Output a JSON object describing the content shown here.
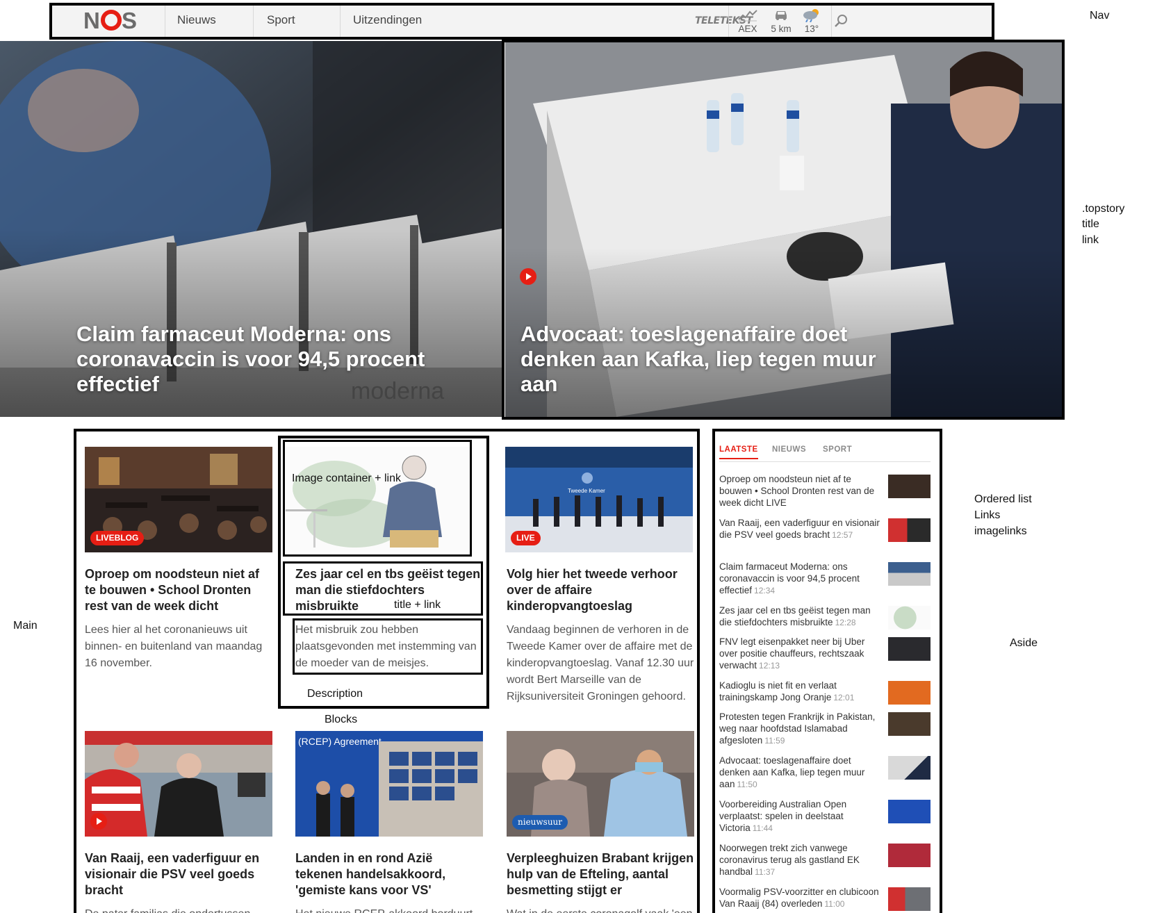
{
  "nav": {
    "logo": "NOS",
    "links": [
      "Nieuws",
      "Sport",
      "Uitzendingen"
    ],
    "teletekst": "TELETEKST",
    "aex_label": "AEX",
    "traffic_label": "5 km",
    "weather_label": "13°",
    "icons": [
      "nos-logo",
      "aex-chart-icon",
      "car-icon",
      "weather-icon",
      "search-icon"
    ]
  },
  "annotations": {
    "nav": "Nav",
    "topstory": ".topstory",
    "topstory_title": "title",
    "topstory_link": "link",
    "main": "Main",
    "image_container": "Image container + link",
    "title_link": "title + link",
    "description": "Description",
    "blocks": "Blocks",
    "ordered_list": "Ordered list",
    "links": "Links",
    "imagelinks": "imagelinks",
    "aside": "Aside"
  },
  "topstories": [
    {
      "title": "Claim farmaceut Moderna: ons coronavaccin is voor 94,5 procent effectief",
      "image_text": "moderna"
    },
    {
      "title": "Advocaat: toeslagenaffaire doet denken aan Kafka, liep tegen muur aan"
    }
  ],
  "blocks": [
    {
      "badge": "LIVEBLOG",
      "title": "Oproep om noodsteun niet af te bouwen • School Dronten rest van de week dicht",
      "description": "Lees hier al het coronanieuws uit binnen- en buitenland van maandag 16 november."
    },
    {
      "badge": "",
      "title": "Zes jaar cel en tbs geëist tegen man die stiefdochters misbruikte",
      "description": "Het misbruik zou hebben plaatsgevonden met instemming van de moeder van de meisjes."
    },
    {
      "badge": "LIVE",
      "title": "Volg hier het tweede verhoor over de affaire kinderopvangtoeslag",
      "description": "Vandaag beginnen de verhoren in de Tweede Kamer over de affaire met de kinderopvangtoeslag. Vanaf 12.30 uur wordt Bert Marseille van de Rijksuniversiteit Groningen gehoord.",
      "image_text": "Tweede Kamer"
    },
    {
      "badge": "",
      "title": "Van Raaij, een vaderfiguur en visionair die PSV veel goeds bracht",
      "description": "De pater familias die ondertussen"
    },
    {
      "badge": "",
      "title": "Landen in en rond Azië tekenen handelsakkoord, 'gemiste kans voor VS'",
      "description": "Het nieuwe RCEP-akkoord borduurt",
      "image_text": "(RCEP) Agreement"
    },
    {
      "badge": "nieuwsuur",
      "title": "Verpleeghuizen Brabant krijgen hulp van de Efteling, aantal besmetting stijgt er",
      "description": "Wat in de eerste coronagolf vaak 'een"
    }
  ],
  "aside": {
    "tabs": [
      "LAATSTE",
      "NIEUWS",
      "SPORT"
    ],
    "items": [
      {
        "text": "Oproep om noodsteun niet af te bouwen • School Dronten rest van de week dicht LIVE",
        "time": ""
      },
      {
        "text": "Van Raaij, een vaderfiguur en visionair die PSV veel goeds bracht",
        "time": "12:57"
      },
      {
        "text": "Claim farmaceut Moderna: ons coronavaccin is voor 94,5 procent effectief",
        "time": "12:34"
      },
      {
        "text": "Zes jaar cel en tbs geëist tegen man die stiefdochters misbruikte",
        "time": "12:28"
      },
      {
        "text": "FNV legt eisenpakket neer bij Uber over positie chauffeurs, rechtszaak verwacht",
        "time": "12:13"
      },
      {
        "text": "Kadioglu is niet fit en verlaat trainingskamp Jong Oranje",
        "time": "12:01"
      },
      {
        "text": "Protesten tegen Frankrijk in Pakistan, weg naar hoofdstad Islamabad afgesloten",
        "time": "11:59"
      },
      {
        "text": "Advocaat: toeslagenaffaire doet denken aan Kafka, liep tegen muur aan",
        "time": "11:50"
      },
      {
        "text": "Voorbereiding Australian Open verplaatst: spelen in deelstaat Victoria",
        "time": "11:44"
      },
      {
        "text": "Noorwegen trekt zich vanwege coronavirus terug als gastland EK handbal",
        "time": "11:37"
      },
      {
        "text": "Voormalig PSV-voorzitter en clubicoon Van Raaij (84) overleden",
        "time": "11:00"
      }
    ]
  },
  "colors": {
    "accent": "#e61e14",
    "nav_bg": "#f3f3f3",
    "badge_blue": "#1d5cb0"
  }
}
